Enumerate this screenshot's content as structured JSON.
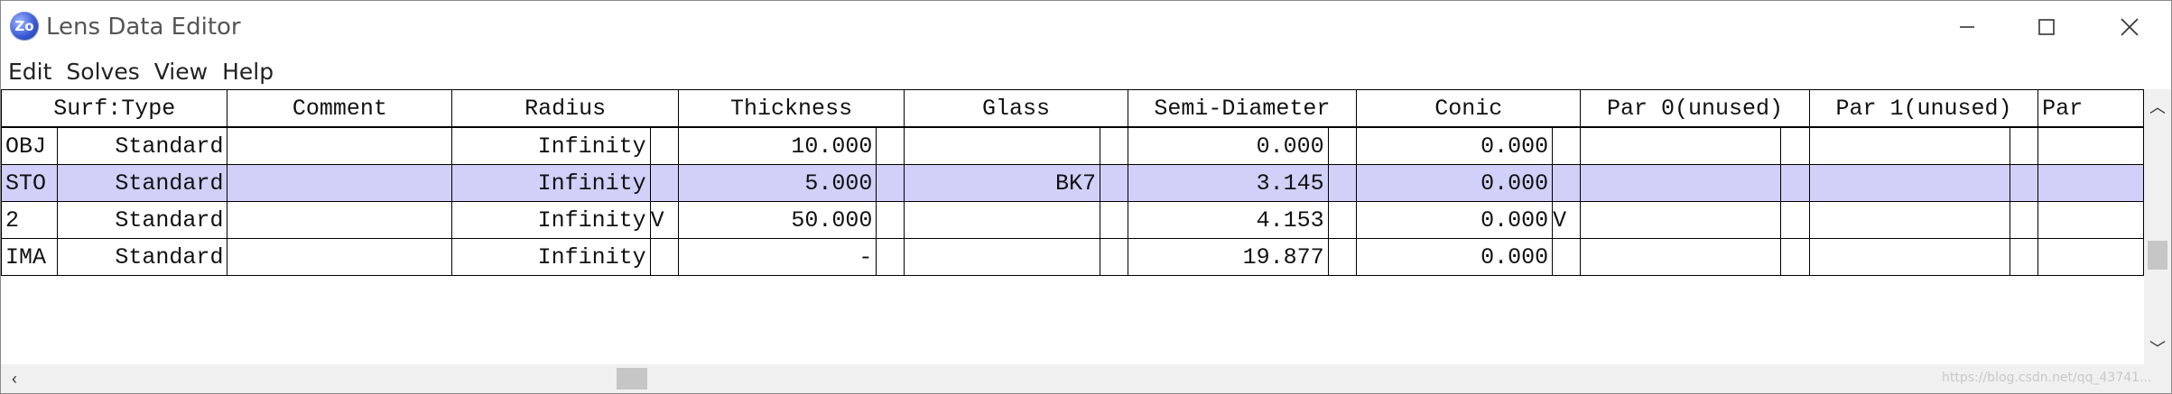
{
  "window": {
    "icon_text": "Zo",
    "title": "Lens Data Editor",
    "controls": {
      "minimize": "minimize-icon",
      "maximize": "maximize-icon",
      "close": "close-icon"
    }
  },
  "menu": [
    "Edit",
    "Solves",
    "View",
    "Help"
  ],
  "columns": [
    "Surf:Type",
    "Comment",
    "Radius",
    "Thickness",
    "Glass",
    "Semi-Diameter",
    "Conic",
    "Par 0(unused)",
    "Par 1(unused)",
    "Par"
  ],
  "rows": [
    {
      "surf": "OBJ",
      "type": "Standard",
      "comment": "",
      "radius": "Infinity",
      "radius_solve": "",
      "thickness": "10.000",
      "thickness_solve": "",
      "glass": "",
      "semi_diameter": "0.000",
      "conic": "0.000",
      "conic_solve": "",
      "selected": false
    },
    {
      "surf": "STO",
      "type": "Standard",
      "comment": "",
      "radius": "Infinity",
      "radius_solve": "",
      "thickness": "5.000",
      "thickness_solve": "",
      "glass": "BK7",
      "semi_diameter": "3.145",
      "conic": "0.000",
      "conic_solve": "",
      "selected": true
    },
    {
      "surf": "2",
      "type": "Standard",
      "comment": "",
      "radius": "Infinity",
      "radius_solve": "V",
      "thickness": "50.000",
      "thickness_solve": "",
      "glass": "",
      "semi_diameter": "4.153",
      "conic": "0.000",
      "conic_solve": "V",
      "selected": false
    },
    {
      "surf": "IMA",
      "type": "Standard",
      "comment": "",
      "radius": "Infinity",
      "radius_solve": "",
      "thickness": "-",
      "thickness_solve": "",
      "glass": "",
      "semi_diameter": "19.877",
      "conic": "0.000",
      "conic_solve": "",
      "selected": false
    }
  ],
  "watermark": "https://blog.csdn.net/qq_43741..."
}
